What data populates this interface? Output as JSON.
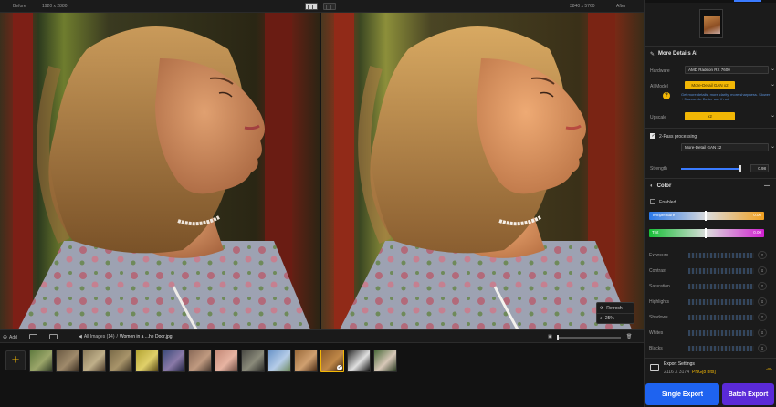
{
  "topbar": {
    "before_label": "Before",
    "before_size": "1920 x 2880",
    "after_size": "3840 x 5760",
    "after_label": "After"
  },
  "viewer": {
    "refresh_label": "Refresh",
    "zoom_value": "25%"
  },
  "browser": {
    "add_label": "Add",
    "folder_label": "All Images (14)",
    "separator": "/",
    "file_label": "Women in a ...he Door.jpg"
  },
  "thumbnails": [
    {
      "colors": [
        "#5f7a3f",
        "#9ba66a",
        "#2f3a24"
      ]
    },
    {
      "colors": [
        "#6b5a43",
        "#9f8a6b",
        "#3c2f22"
      ]
    },
    {
      "colors": [
        "#8a7a5a",
        "#c0b08a",
        "#4a3a2a"
      ]
    },
    {
      "colors": [
        "#7a6a48",
        "#a8946a",
        "#3e3424"
      ]
    },
    {
      "colors": [
        "#b4a534",
        "#e0d06a",
        "#5a4a16"
      ]
    },
    {
      "colors": [
        "#3a4a7a",
        "#8a7aa8",
        "#1e2240"
      ]
    },
    {
      "colors": [
        "#8a6a58",
        "#c09a80",
        "#4a3a30"
      ]
    },
    {
      "colors": [
        "#c48a78",
        "#e7b4a2",
        "#6a4a40"
      ]
    },
    {
      "colors": [
        "#4a4a44",
        "#8a8a7a",
        "#2a2a26"
      ]
    },
    {
      "colors": [
        "#6a94c8",
        "#b5cce8",
        "#6f8a5e"
      ]
    },
    {
      "colors": [
        "#9a6a3a",
        "#d0a070",
        "#4a2a14"
      ]
    },
    {
      "colors": [
        "#8a5a2a",
        "#c08848",
        "#3a2410"
      ]
    },
    {
      "colors": [
        "#2a2a2a",
        "#e0e0e0",
        "#101010"
      ]
    },
    {
      "colors": [
        "#4a6a3a",
        "#d8c8b8",
        "#2a3a22"
      ]
    }
  ],
  "panel": {
    "section_title": "More Details AI",
    "hardware_label": "Hardware",
    "hardware_value": "AMD Radeon RX 7600",
    "ai_model_label": "AI Model",
    "ai_model_value": "More-Detail GAN  x2",
    "ai_model_note": "Get more details, more clarity, more sharpness. Slower + 3 seconds. Better use if not.",
    "upscale_label": "Upscale",
    "upscale_value": "x2",
    "twopass_label": "2-Pass processing",
    "twopass_value": "More-Detail GAN  x2",
    "strength_label": "Strength",
    "strength_value": "0.98",
    "strength_level": 0.98,
    "color_title": "Color",
    "enabled_label": "Enabled",
    "temperature_label": "Temperature",
    "temperature_value": "0.00",
    "tint_label": "Tint",
    "tint_value": "0.00",
    "adjustments": [
      "Exposure",
      "Contrast",
      "Saturation",
      "Highlights",
      "Shadows",
      "Whites",
      "Blacks"
    ],
    "export_settings_label": "Export Settings",
    "export_size": "2116 X 3174",
    "export_format": "PNG",
    "export_bits": "[8 bits]",
    "single_export_label": "Single Export",
    "batch_export_label": "Batch Export"
  },
  "colors": {
    "accent_yellow": "#f2b705",
    "accent_blue": "#3a7bff",
    "export_blue": "#1e63f0",
    "batch_purple": "#5a2ad8"
  }
}
